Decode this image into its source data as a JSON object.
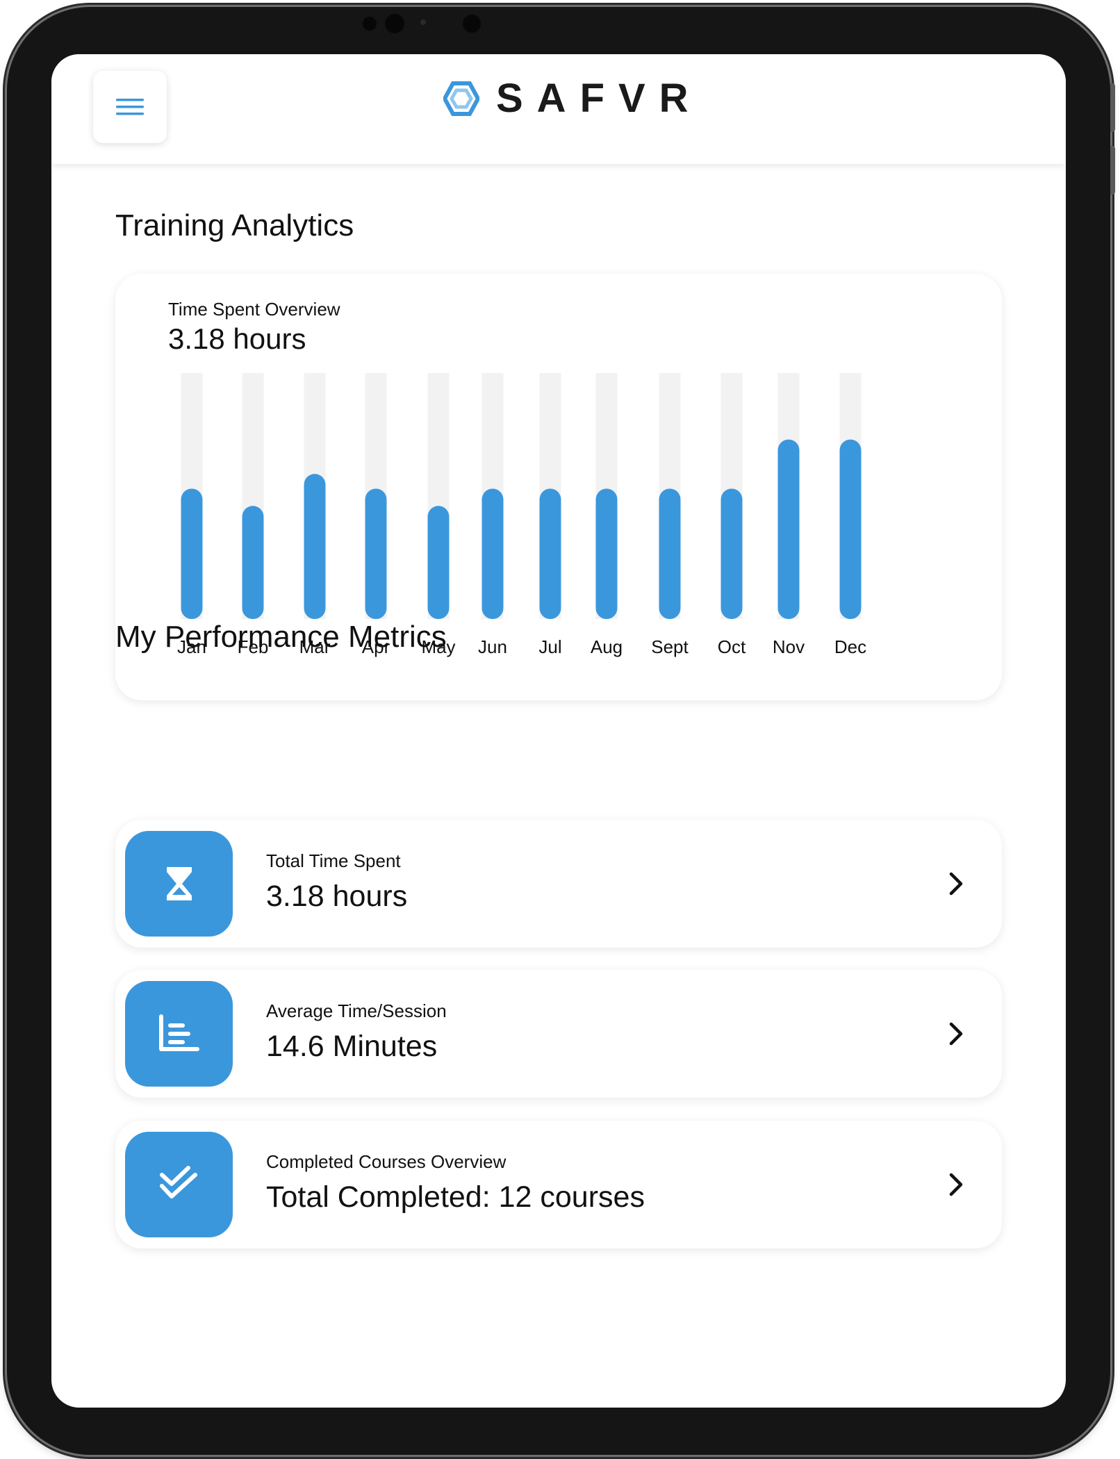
{
  "app": {
    "name": "SAFVR"
  },
  "header": {
    "menu_icon": "hamburger-menu-icon",
    "logo_icon": "safvr-hexagon-logo-icon",
    "logo_text": "SAFVR"
  },
  "page": {
    "title": "Training Analytics"
  },
  "chart_card": {
    "label": "Time Spent Overview",
    "value": "3.18 hours"
  },
  "chart_data": {
    "type": "bar",
    "title": "Time Spent Overview",
    "categories": [
      "Jan",
      "Feb",
      "Mar",
      "Apr",
      "May",
      "Jun",
      "Jul",
      "Aug",
      "Sept",
      "Oct",
      "Nov",
      "Dec"
    ],
    "values": [
      0.53,
      0.46,
      0.59,
      0.53,
      0.46,
      0.53,
      0.53,
      0.53,
      0.53,
      0.53,
      0.73,
      0.73
    ],
    "ylim": [
      0,
      1
    ],
    "grid": false,
    "colors": {
      "bar": "#3b97dc",
      "track": "#f2f2f2"
    }
  },
  "metrics_section": {
    "title": "My Performance Metrics"
  },
  "metrics": [
    {
      "icon": "hourglass-icon",
      "label": "Total Time Spent",
      "value": "3.18 hours"
    },
    {
      "icon": "bar-chart-icon",
      "label": "Average Time/Session",
      "value": "14.6 Minutes"
    },
    {
      "icon": "double-check-icon",
      "label": "Completed Courses Overview",
      "value": "Total Completed: 12 courses"
    }
  ],
  "colors": {
    "accent": "#3b97dc",
    "text": "#111111"
  }
}
